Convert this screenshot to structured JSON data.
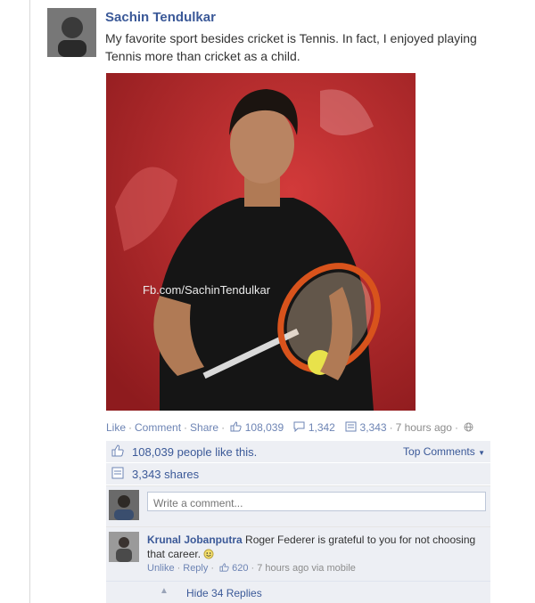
{
  "post": {
    "author": "Sachin Tendulkar",
    "text": "My favorite sport besides cricket is Tennis. In fact, I enjoyed playing Tennis more than cricket as a child.",
    "photo_watermark": "Fb.com/SachinTendulkar",
    "photo_description": "Sachin Tendulkar holding a tennis racket"
  },
  "actions": {
    "like": "Like",
    "comment": "Comment",
    "share": "Share",
    "like_count": "108,039",
    "comment_count": "1,342",
    "share_count": "3,343",
    "time": "7 hours ago"
  },
  "summary": {
    "likes_text": "108,039 people like this.",
    "top_comments": "Top Comments",
    "shares_text": "3,343 shares"
  },
  "composer": {
    "placeholder": "Write a comment..."
  },
  "comment": {
    "author": "Krunal Jobanputra",
    "text": "Roger Federer is grateful to you for not choosing that career.",
    "unlike": "Unlike",
    "reply": "Reply",
    "likes": "620",
    "time": "7 hours ago via mobile"
  },
  "replies": {
    "hide_label": "Hide 34 Replies"
  },
  "colors": {
    "link": "#3b5998",
    "panel": "#edeff4",
    "photo_bg": "#b3262a"
  }
}
